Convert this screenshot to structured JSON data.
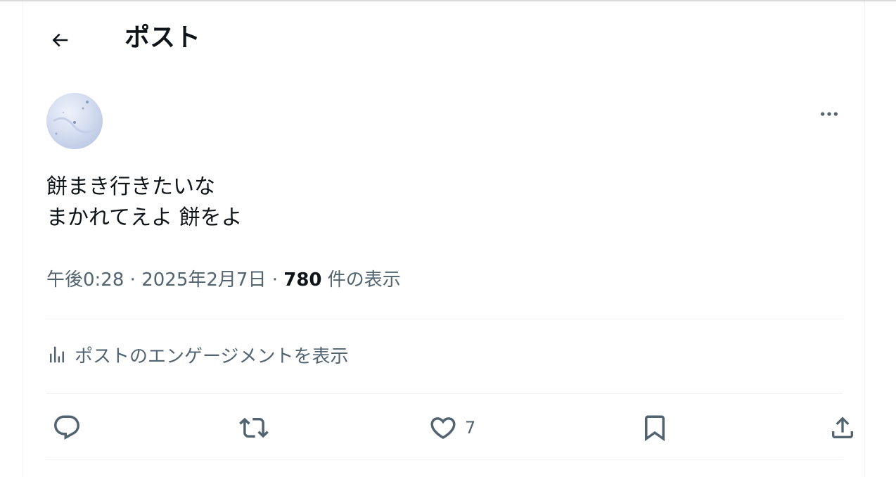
{
  "header": {
    "title": "ポスト"
  },
  "tweet": {
    "text": "餅まき行きたいな\nまかれてえよ 餅をよ",
    "time": "午後0:28",
    "dot1": "·",
    "date": "2025年2月7日",
    "dot2": "·",
    "views": "780",
    "views_label": " 件の表示"
  },
  "engagement": {
    "label": "ポストのエンゲージメントを表示"
  },
  "actions": {
    "like_count": "7"
  },
  "icons": {
    "back": "arrow-left-icon",
    "more": "more-horizontal-icon",
    "analytics": "bar-chart-icon",
    "reply": "reply-icon",
    "repost": "repost-icon",
    "like": "heart-icon",
    "bookmark": "bookmark-icon",
    "share": "share-icon"
  },
  "colors": {
    "text_primary": "#0f1419",
    "text_secondary": "#536471",
    "divider": "#eff3f4"
  }
}
